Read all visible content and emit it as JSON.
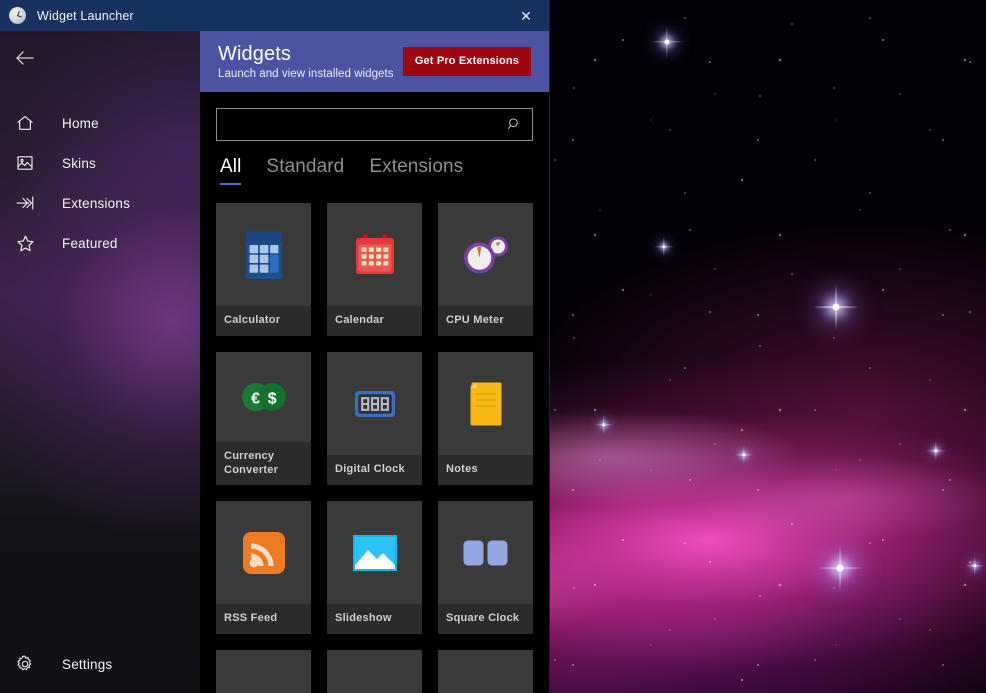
{
  "window": {
    "title": "Widget Launcher",
    "app_icon": "clock-icon",
    "close_label": "✕",
    "titlebar_color": "#17325e"
  },
  "sidebar": {
    "back_label": "back-arrow-icon",
    "items": [
      {
        "label": "Home",
        "icon": "home-icon"
      },
      {
        "label": "Skins",
        "icon": "image-icon"
      },
      {
        "label": "Extensions",
        "icon": "arrow-to-line-icon"
      },
      {
        "label": "Featured",
        "icon": "star-icon"
      }
    ],
    "settings": {
      "label": "Settings",
      "icon": "gear-icon"
    }
  },
  "header": {
    "title": "Widgets",
    "subtitle": "Launch and view installed widgets",
    "cta_label": "Get Pro Extensions",
    "cta_color": "#9e0710",
    "background": "#4a54a3"
  },
  "search": {
    "value": "",
    "placeholder": "",
    "icon": "search-icon"
  },
  "tabs": [
    {
      "label": "All",
      "active": true
    },
    {
      "label": "Standard",
      "active": false
    },
    {
      "label": "Extensions",
      "active": false
    }
  ],
  "accent_color": "#5f6bc4",
  "widgets": [
    {
      "name": "Calculator",
      "icon": "calculator-icon"
    },
    {
      "name": "Calendar",
      "icon": "calendar-icon"
    },
    {
      "name": "CPU Meter",
      "icon": "cpu-meter-icon"
    },
    {
      "name": "Currency Converter",
      "icon": "currency-converter-icon"
    },
    {
      "name": "Digital Clock",
      "icon": "digital-clock-icon"
    },
    {
      "name": "Notes",
      "icon": "notes-icon"
    },
    {
      "name": "RSS Feed",
      "icon": "rss-feed-icon"
    },
    {
      "name": "Slideshow",
      "icon": "slideshow-icon"
    },
    {
      "name": "Square Clock",
      "icon": "square-clock-icon"
    },
    {
      "name": "",
      "icon": ""
    },
    {
      "name": "",
      "icon": ""
    },
    {
      "name": "",
      "icon": ""
    }
  ],
  "desktop": {
    "wallpaper": "space-nebula-stars"
  }
}
